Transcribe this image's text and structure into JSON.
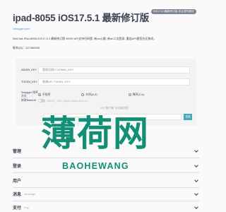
{
  "header": {
    "title": "ipad-8055 iOS17.5.1 最新修订版",
    "version_badge": "iOS17.5.1最新修订版, 防止账号被封",
    "swagger_link": "/swagger.json",
    "description": "WeChat-iPad-8055-iOS17.5.1 最新修订版 WSS+API支持扫码登, 新dn心跳, 新dn二次登录, 重连API稳签名迁移发。",
    "contact": "联系QQ：327366009"
  },
  "config": {
    "admin_key": {
      "label": "ADMIN_KEY",
      "placeholder": "管理员接口 ADMIN_KEY"
    },
    "token_key": {
      "label": "TOKEN_KEY",
      "placeholder": "普通API TOKEN_KEY"
    },
    "swagger_order": {
      "label": "Swagger 排序方式",
      "options": [
        {
          "label": "不排序",
          "checked": true
        },
        {
          "label": "升序(A-Z)",
          "checked": false
        },
        {
          "label": "降序(Z-A)",
          "checked": false
        }
      ]
    },
    "base_url": {
      "label": "修改BaseUrl",
      "text": "BASE_URL: https://www.9cm.cn"
    },
    "ws": {
      "status": "WS 客户端: 未连接状态",
      "url": "wss://www.9cm.cn/ws/GetSyncMsg?key=",
      "button": "连接"
    }
  },
  "sections": [
    {
      "title": "管理",
      "subtitle": ""
    },
    {
      "title": "登录",
      "subtitle": ""
    },
    {
      "title": "用户",
      "subtitle": ""
    },
    {
      "title": "消息",
      "subtitle": "Message"
    },
    {
      "title": "支付",
      "subtitle": "Pay"
    }
  ],
  "watermark": {
    "cn": "薄荷网",
    "en": "BAOHEWANG"
  }
}
